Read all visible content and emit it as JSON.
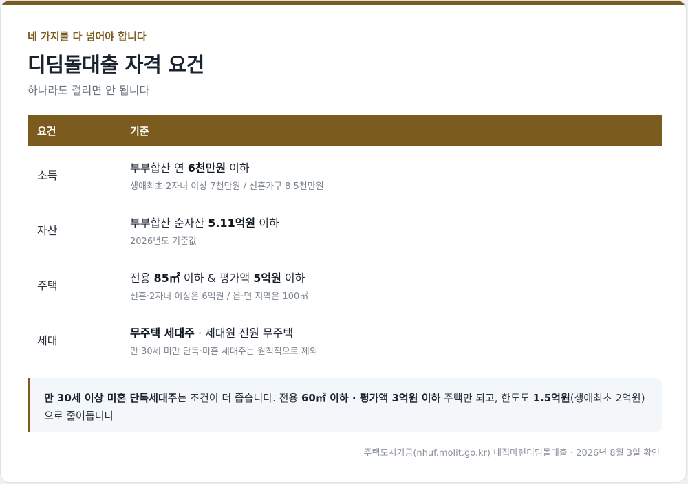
{
  "header": {
    "eyebrow": "네 가지를 다 넘어야 합니다",
    "title": "디딤돌대출 자격 요건",
    "subtitle": "하나라도 걸리면 안 됩니다"
  },
  "table": {
    "columns": [
      "요건",
      "기준"
    ],
    "rows": [
      {
        "label": "소득",
        "main": {
          "pre": "부부합산 연 ",
          "strong": "6천만원",
          "post": " 이하"
        },
        "sub": "생애최초·2자녀 이상 7천만원 / 신혼가구 8.5천만원"
      },
      {
        "label": "자산",
        "main": {
          "pre": "부부합산 순자산 ",
          "strong": "5.11억원",
          "post": " 이하"
        },
        "sub": "2026년도 기준값"
      },
      {
        "label": "주택",
        "main": {
          "pre": "전용 ",
          "strong": "85㎡",
          "mid": " 이하 & 평가액 ",
          "strong2": "5억원",
          "post": " 이하"
        },
        "sub": "신혼·2자녀 이상은 6억원 / 읍·면 지역은 100㎡"
      },
      {
        "label": "세대",
        "main": {
          "pre": "",
          "strong": "무주택 세대주",
          "post": " · 세대원 전원 무주택"
        },
        "sub": "만 30세 미만 단독·미혼 세대주는 원칙적으로 제외"
      }
    ]
  },
  "note": {
    "s1": "만 30세 이상 미혼 단독세대주",
    "t1": "는 조건이 더 좁습니다. 전용 ",
    "s2": "60㎡ 이하 · 평가액 3억원 이하",
    "t2": " 주택만 되고, 한도도 ",
    "s3": "1.5억원",
    "t3": "(생애최초 2억원)으로 줄어듭니다"
  },
  "source": "주택도시기금(nhuf.molit.go.kr) 내집마련디딤돌대출 · 2026년 8월 3일 확인",
  "colors": {
    "accent": "#7c5b1f",
    "note_bg": "#f4f7fa"
  }
}
